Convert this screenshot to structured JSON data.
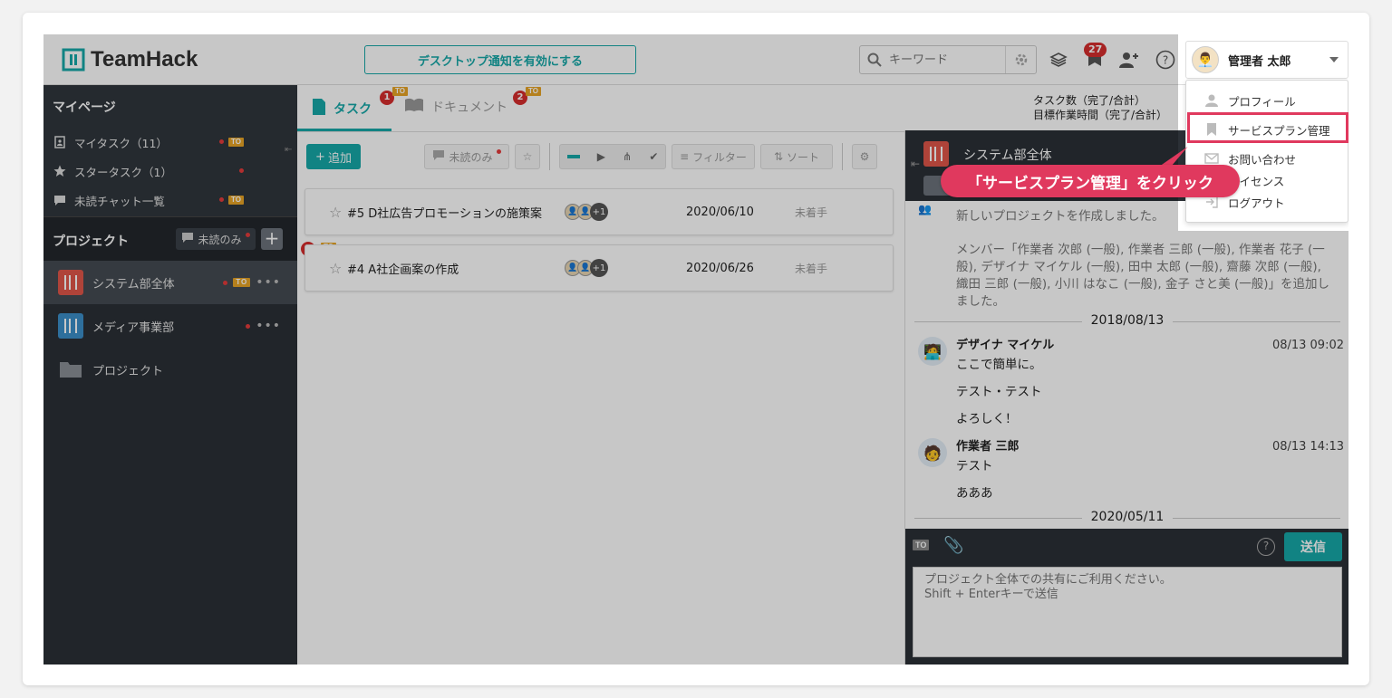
{
  "app": {
    "name": "TeamHack"
  },
  "header": {
    "notify_button": "デスクトップ通知を有効にする",
    "search_placeholder": "キーワード",
    "notification_count": "27",
    "user_name": "管理者 太郎"
  },
  "user_menu": {
    "items": [
      {
        "label": "プロフィール",
        "icon": "person-icon"
      },
      {
        "label": "サービスプラン管理",
        "icon": "bookmark-icon"
      },
      {
        "label": "お問い合わせ",
        "icon": "mail-icon"
      },
      {
        "label": "ライセンス",
        "icon": "license-icon"
      },
      {
        "label": "ログアウト",
        "icon": "logout-icon"
      }
    ]
  },
  "callout": {
    "text": "「サービスプラン管理」をクリック",
    "color": "#e0395e"
  },
  "sidebar": {
    "mypage_title": "マイページ",
    "mypage_items": [
      {
        "label": "マイタスク（11）",
        "to": true
      },
      {
        "label": "スタータスク（1）",
        "to": false
      },
      {
        "label": "未読チャット一覧",
        "to": true
      }
    ],
    "projects_title": "プロジェクト",
    "unread_only": "未読のみ",
    "projects": [
      {
        "label": "システム部全体",
        "color": "#e0574a",
        "active": true,
        "to": true
      },
      {
        "label": "メディア事業部",
        "color": "#3c8fc8",
        "active": false,
        "to": false
      },
      {
        "label": "プロジェクト",
        "folder": true
      }
    ],
    "to_label": "TO"
  },
  "tabs": {
    "task": {
      "label": "タスク",
      "badge": "1"
    },
    "document": {
      "label": "ドキュメント",
      "badge": "2"
    }
  },
  "stats": {
    "task_count_label": "タスク数（完了/合計）",
    "work_hours_label": "目標作業時間（完了/合計）"
  },
  "toolbar": {
    "add": "追加",
    "unread_only": "未読のみ",
    "filter": "フィルター",
    "sort": "ソート"
  },
  "tasks": [
    {
      "title": "#5  D社広告プロモーションの施策案",
      "date": "2020/06/10",
      "status": "未着手",
      "extra": "+1",
      "badge": ""
    },
    {
      "title": "#4  A社企画案の作成",
      "date": "2020/06/26",
      "status": "未着手",
      "extra": "+1",
      "badge": "1"
    }
  ],
  "chat": {
    "project": "システム部全体",
    "system_message": "新しいプロジェクトを作成しました。",
    "member_message": "メンバー「作業者 次郎 (一般), 作業者 三郎 (一般), 作業者 花子 (一般), デザイナ マイケル (一般), 田中 太郎 (一般), 齋藤 次郎 (一般), 織田 三郎 (一般), 小川 はなこ (一般), 金子 さと美 (一般)」を追加しました。",
    "date1": "2018/08/13",
    "messages": [
      {
        "author": "デザイナ マイケル",
        "time": "08/13 09:02",
        "lines": [
          "ここで簡単に。",
          "テスト・テスト",
          "よろしく！"
        ]
      },
      {
        "author": "作業者 三郎",
        "time": "08/13 14:13",
        "lines": [
          "テスト",
          "あああ"
        ]
      }
    ],
    "date2": "2020/05/11",
    "send": "送信",
    "composer_placeholder": "プロジェクト全体での共有にご利用ください。\nShift + Enterキーで送信"
  },
  "colors": {
    "accent": "#16a8a8",
    "sidebar": "#2b3036",
    "highlight": "#e0395e"
  }
}
